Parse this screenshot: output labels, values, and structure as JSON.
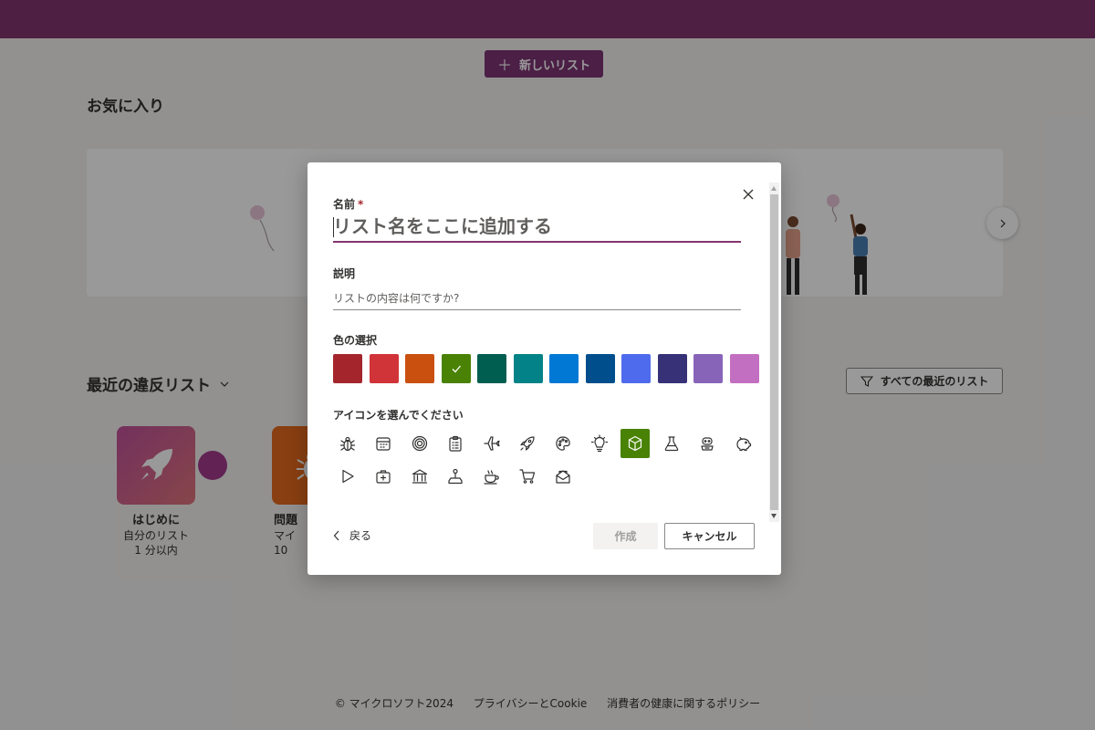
{
  "header": {
    "new_list_label": "新しいリスト"
  },
  "favorites": {
    "title": "お気に入り"
  },
  "recent": {
    "title": "最近の違反リスト",
    "all_recent_label": "すべての最近のリスト",
    "tiles": [
      {
        "name": "はじめに",
        "owner": "自分のリスト",
        "time": "1 分以内"
      },
      {
        "name": "問題",
        "owner": "マイ",
        "time": "10"
      }
    ]
  },
  "dialog": {
    "name_label": "名前",
    "required_mark": "*",
    "name_placeholder": "リスト名をここに追加する",
    "description_label": "説明",
    "description_placeholder": "リストの内容は何ですか?",
    "color_label": "色の選択",
    "colors": [
      "#a4262c",
      "#d13438",
      "#ca5010",
      "#498205",
      "#005e50",
      "#038387",
      "#0078d4",
      "#004e8c",
      "#4f6bed",
      "#373277",
      "#8764b8",
      "#c36fc1"
    ],
    "selected_color_index": 3,
    "icon_label": "アイコンを選んでください",
    "icons": [
      "bug-icon",
      "calendar-icon",
      "target-icon",
      "clipboard-icon",
      "airplane-icon",
      "rocket-icon",
      "palette-icon",
      "lightbulb-icon",
      "cube-icon",
      "flask-icon",
      "robot-icon",
      "piggy-bank-icon",
      "play-icon",
      "medical-kit-icon",
      "bank-icon",
      "joystick-icon",
      "coffee-icon",
      "cart-icon",
      "mail-icon"
    ],
    "selected_icon": "cube-icon",
    "back_label": "戻る",
    "create_label": "作成",
    "cancel_label": "キャンセル"
  },
  "footer": {
    "copyright": "© マイクロソフト2024",
    "privacy": "プライバシーとCookie",
    "health_policy": "消費者の健康に関するポリシー"
  }
}
